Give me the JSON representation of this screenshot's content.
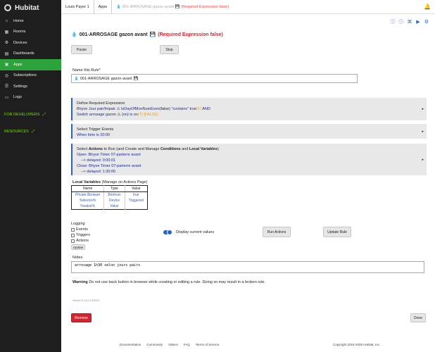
{
  "brand": "Hubitat",
  "sidebar": {
    "items": [
      {
        "label": "Home",
        "icon": "home-icon"
      },
      {
        "label": "Rooms",
        "icon": "rooms-icon"
      },
      {
        "label": "Devices",
        "icon": "devices-icon"
      },
      {
        "label": "Dashboards",
        "icon": "dashboards-icon"
      },
      {
        "label": "Apps",
        "icon": "apps-icon"
      },
      {
        "label": "Subscriptions",
        "icon": "subscriptions-icon"
      },
      {
        "label": "Settings",
        "icon": "settings-icon"
      },
      {
        "label": "Logs",
        "icon": "logs-icon"
      }
    ],
    "group_dev": "FOR DEVELOPERS",
    "group_res": "RESOURCES"
  },
  "topbar": {
    "crumb1": "Louis Payer 1",
    "crumb2": "Apps",
    "crumb3_main": "001-ARROSAGE gazon avant",
    "crumb3_req": "(Required Expression false)"
  },
  "page": {
    "title_main": "001-ARROSAGE gazon avant",
    "title_req": "(Required Expression false)",
    "pause": "Pause",
    "stop": "Stop",
    "name_label": "Name this Rule*",
    "name_value": "001-ARROSAGE gazon avant"
  },
  "sections": {
    "req": {
      "head": "Define Required Expression",
      "l1_a": "Bhyve Jour pair/Impair",
      "l1_b": "IsDayOfMonNumEven(",
      "l1_c": "false",
      "l1_d": ") \"contains\" true",
      "l1_e": "(F)",
      "l1_f": "AND",
      "l2_a": "Switch arrosage gazon",
      "l2_b": "(on) is on",
      "l2_c": "(T)",
      "l2_d": "[FALSE]"
    },
    "trigger": {
      "head": "Select Trigger Events",
      "line": "When time is 20:00"
    },
    "actions": {
      "head_a": "Select ",
      "head_b": "Actions",
      "head_c": " to Run (and Create and Manage ",
      "head_d": "Conditions",
      "head_e": " and ",
      "head_f": "Local Variables",
      "head_g": ")",
      "lines": [
        "Open: Bhyve Timer 07-parterre avant",
        "--> delayed: 0:00:01",
        "Close: Bhyve Timer 07-parterre avant",
        "--> delayed: 1:30:00"
      ]
    }
  },
  "local_vars": {
    "title": "Local Variables",
    "manage": "(Manage on Actions Page)",
    "headers": [
      "Name",
      "Type",
      "Value"
    ],
    "rows": [
      [
        "Private Boolean",
        "Boolean",
        "true"
      ],
      [
        "%device%",
        "Device",
        "Triggered"
      ],
      [
        "%value%",
        "Value",
        ""
      ]
    ]
  },
  "logging": {
    "title": "Logging",
    "options": [
      "Events",
      "Triggers",
      "Actions"
    ],
    "update": "Update",
    "display_current": "Display current values",
    "run_actions": "Run Actions",
    "update_rule": "Update Rule"
  },
  "notes": {
    "label": "Notes",
    "value": "arrosage 1h30 selon jours pairs"
  },
  "warning": {
    "bold": "Warning",
    "text": " Do not use back button in browser while creating or editing a rule. Doing so may result in a broken rule."
  },
  "version": "Version 5.1.8.4 0.5/2020",
  "remove": "Remove",
  "done": "Done",
  "footer": {
    "links": [
      "Documentation",
      "Community",
      "Videos",
      "FAQ",
      "Terms of Service"
    ],
    "copyright": "Copyright 2018-2025 Hubitat, Inc."
  },
  "colors": {
    "active_nav": "#29a33a",
    "accent": "#2a63c7",
    "req_red": "#e0202a",
    "remove_red": "#d9232e"
  }
}
